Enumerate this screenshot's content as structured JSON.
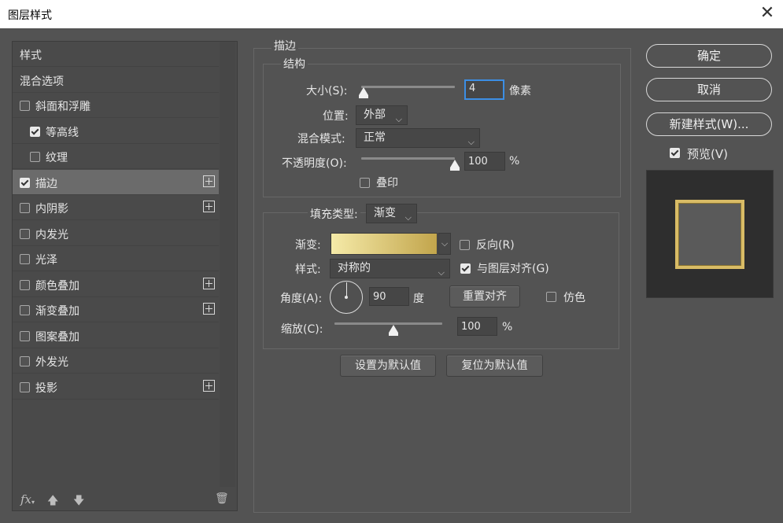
{
  "window": {
    "title": "图层样式",
    "close_glyph": "✕"
  },
  "left_panel": {
    "items": [
      {
        "label": "样式",
        "checkbox": null,
        "plus": false,
        "selected": false
      },
      {
        "label": "混合选项",
        "checkbox": null,
        "plus": false,
        "selected": false
      },
      {
        "label": "斜面和浮雕",
        "checkbox": false,
        "plus": false,
        "selected": false
      },
      {
        "label": "等高线",
        "checkbox": true,
        "plus": false,
        "selected": false
      },
      {
        "label": "纹理",
        "checkbox": false,
        "plus": false,
        "selected": false
      },
      {
        "label": "描边",
        "checkbox": true,
        "plus": true,
        "selected": true
      },
      {
        "label": "内阴影",
        "checkbox": false,
        "plus": true,
        "selected": false
      },
      {
        "label": "内发光",
        "checkbox": false,
        "plus": false,
        "selected": false
      },
      {
        "label": "光泽",
        "checkbox": false,
        "plus": false,
        "selected": false
      },
      {
        "label": "颜色叠加",
        "checkbox": false,
        "plus": true,
        "selected": false
      },
      {
        "label": "渐变叠加",
        "checkbox": false,
        "plus": true,
        "selected": false
      },
      {
        "label": "图案叠加",
        "checkbox": false,
        "plus": false,
        "selected": false
      },
      {
        "label": "外发光",
        "checkbox": false,
        "plus": false,
        "selected": false
      },
      {
        "label": "投影",
        "checkbox": false,
        "plus": true,
        "selected": false
      }
    ],
    "bottom_icons": {
      "fx": "fx",
      "up": "🡅",
      "down": "🡇",
      "trash": "🗑"
    }
  },
  "stroke": {
    "section_title": "描边",
    "structure_title": "结构",
    "size_label": "大小(S):",
    "size_value": "4",
    "size_unit": "像素",
    "size_slider_fraction": 0.01,
    "position_label": "位置:",
    "position_value": "外部",
    "blend_label": "混合模式:",
    "blend_value": "正常",
    "opacity_label": "不透明度(O):",
    "opacity_value": "100",
    "opacity_unit": "%",
    "opacity_fraction": 1.0,
    "overprint_label": "叠印",
    "overprint_checked": false
  },
  "fill": {
    "type_label": "填充类型:",
    "type_value": "渐变",
    "gradient_label": "渐变:",
    "gradient_colors": [
      "#f5eaa8",
      "#c2a54c"
    ],
    "reverse_label": "反向(R)",
    "reverse_checked": false,
    "style_label": "样式:",
    "style_value": "对称的",
    "align_label": "与图层对齐(G)",
    "align_checked": true,
    "angle_label": "角度(A):",
    "angle_value": "90",
    "angle_unit": "度",
    "reset_align_label": "重置对齐",
    "dither_label": "仿色",
    "dither_checked": false,
    "scale_label": "缩放(C):",
    "scale_value": "100",
    "scale_unit": "%",
    "scale_fraction": 0.55
  },
  "defaults": {
    "set_default": "设置为默认值",
    "reset_default": "复位为默认值"
  },
  "right": {
    "ok": "确定",
    "cancel": "取消",
    "new_style": "新建样式(W)...",
    "preview_label": "预览(V)",
    "preview_checked": true,
    "preview_stroke_color": "#d9bc66"
  },
  "dropdown_arrow": "⌵"
}
